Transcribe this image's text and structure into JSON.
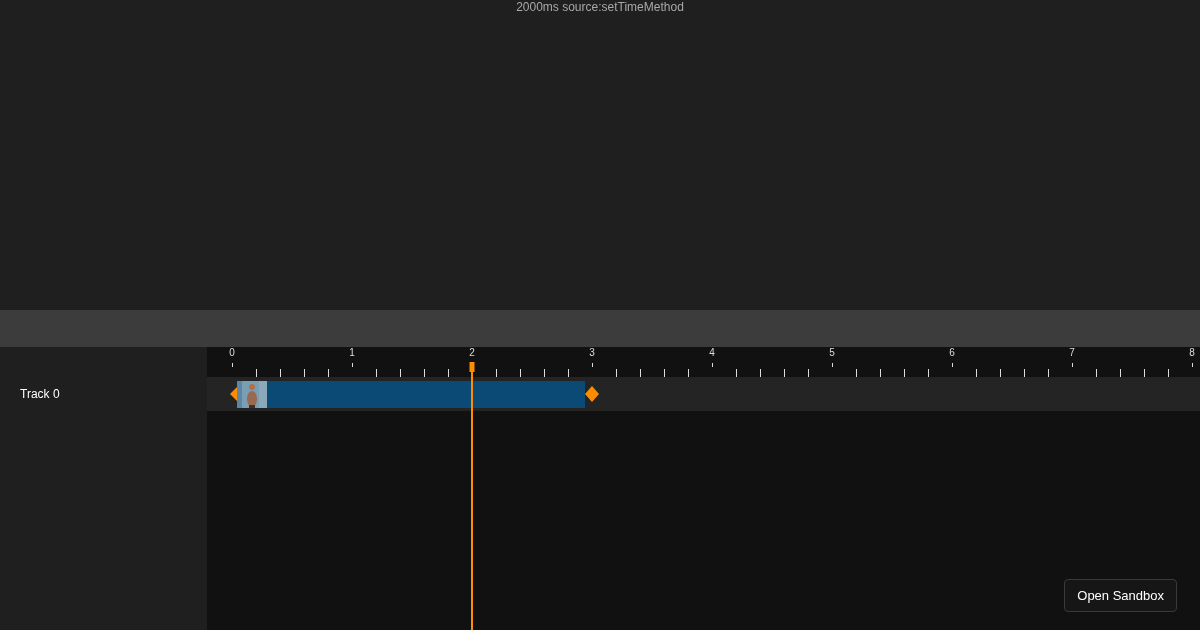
{
  "preview": {
    "caption": "2000ms source:setTimeMethod"
  },
  "tracks": [
    {
      "label": "Track 0"
    }
  ],
  "ruler": {
    "labels": [
      "0",
      "1",
      "2",
      "3",
      "4",
      "5",
      "6",
      "7",
      "8"
    ]
  },
  "playhead": {
    "level": 0.25
  },
  "button": {
    "label": "Open Sandbox"
  }
}
